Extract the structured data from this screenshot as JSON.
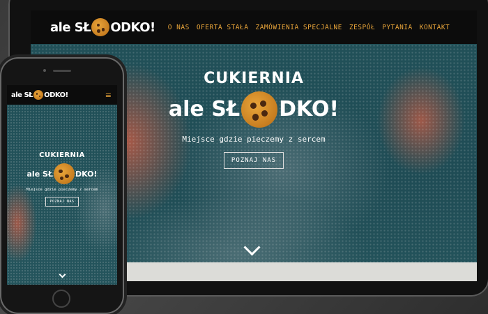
{
  "site": {
    "logo": {
      "prefix": "ale SŁ",
      "suffix": "ODKO!",
      "icon": "cookie-icon"
    },
    "nav": [
      {
        "label": "O NAS"
      },
      {
        "label": "OFERTA STAŁA"
      },
      {
        "label": "ZAMÓWIENIA SPECJALNE"
      },
      {
        "label": "ZESPÓŁ"
      },
      {
        "label": "PYTANIA"
      },
      {
        "label": "KONTAKT"
      }
    ],
    "hero": {
      "title": "CUKIERNIA",
      "brand_prefix": "ale SŁ",
      "brand_suffix": "DKO!",
      "tagline": "Miejsce gdzie pieczemy z sercem",
      "button": "POZNAJ NAS"
    },
    "mobile": {
      "logo_prefix": "ale SŁ",
      "logo_suffix": "ODKO!",
      "menu_icon": "hamburger-icon",
      "title": "CUKIERNIA",
      "brand_prefix": "ale SŁ",
      "brand_suffix": "DKO!",
      "tagline": "Miejsce gdzie pieczemy z sercem",
      "button": "POZNAJ NAS"
    },
    "colors": {
      "accent": "#e9a53a",
      "navbar": "#0c0c0c",
      "hero": "#215058"
    }
  }
}
